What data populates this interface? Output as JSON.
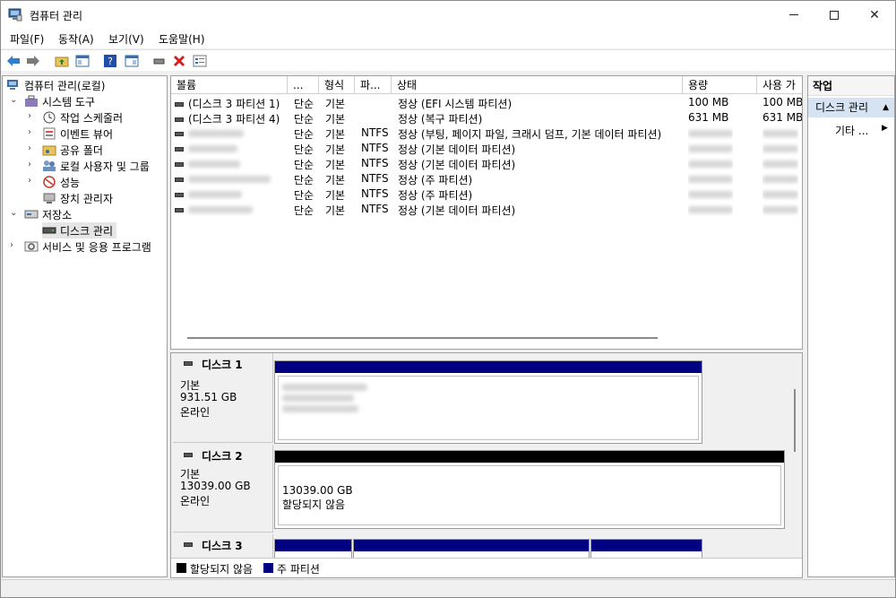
{
  "window": {
    "title": "컴퓨터 관리"
  },
  "menu": [
    "파일(F)",
    "동작(A)",
    "보기(V)",
    "도움말(H)"
  ],
  "toolbar": {
    "icons": [
      "back-arrow-icon",
      "forward-arrow-icon",
      "up-folder-icon",
      "show-hide-tree-icon",
      "help-icon",
      "show-hide-action-icon",
      "connect-icon",
      "delete-icon",
      "properties-icon"
    ]
  },
  "tree": {
    "root": "컴퓨터 관리(로컬)",
    "system_tools": "시스템 도구",
    "task_scheduler": "작업 스케줄러",
    "event_viewer": "이벤트 뷰어",
    "shared_folders": "공유 폴더",
    "local_users": "로컬 사용자 및 그룹",
    "performance": "성능",
    "device_manager": "장치 관리자",
    "storage": "저장소",
    "disk_management": "디스크 관리",
    "services": "서비스 및 응용 프로그램"
  },
  "volumes": {
    "columns": [
      "볼륨",
      "...",
      "형식",
      "파...",
      "상태",
      "용량",
      "사용 가"
    ],
    "rows": [
      {
        "name": "(디스크 3 파티션 1)",
        "layout": "단순",
        "type": "기본",
        "fs": "",
        "status": "정상 (EFI 시스템 파티션)",
        "capacity": "100 MB",
        "free": "100 MB"
      },
      {
        "name": "(디스크 3 파티션 4)",
        "layout": "단순",
        "type": "기본",
        "fs": "",
        "status": "정상 (복구 파티션)",
        "capacity": "631 MB",
        "free": "631 MB"
      },
      {
        "name": "",
        "layout": "단순",
        "type": "기본",
        "fs": "NTFS",
        "status": "정상 (부팅, 페이지 파일, 크래시 덤프, 기본 데이터 파티션)",
        "capacity": "",
        "free": ""
      },
      {
        "name": "",
        "layout": "단순",
        "type": "기본",
        "fs": "NTFS",
        "status": "정상 (기본 데이터 파티션)",
        "capacity": "",
        "free": ""
      },
      {
        "name": "",
        "layout": "단순",
        "type": "기본",
        "fs": "NTFS",
        "status": "정상 (기본 데이터 파티션)",
        "capacity": "",
        "free": ""
      },
      {
        "name": "",
        "layout": "단순",
        "type": "기본",
        "fs": "NTFS",
        "status": "정상 (주 파티션)",
        "capacity": "",
        "free": ""
      },
      {
        "name": "",
        "layout": "단순",
        "type": "기본",
        "fs": "NTFS",
        "status": "정상 (주 파티션)",
        "capacity": "",
        "free": ""
      },
      {
        "name": "",
        "layout": "단순",
        "type": "기본",
        "fs": "NTFS",
        "status": "정상 (기본 데이터 파티션)",
        "capacity": "",
        "free": ""
      }
    ]
  },
  "disks": [
    {
      "name": "디스크 1",
      "type": "기본",
      "size": "931.51 GB",
      "state": "온라인"
    },
    {
      "name": "디스크 2",
      "type": "기본",
      "size": "13039.00 GB",
      "state": "온라인",
      "partition_size": "13039.00 GB",
      "partition_label": "할당되지 않음"
    },
    {
      "name": "디스크 3"
    }
  ],
  "legend": {
    "unallocated": "할당되지 않음",
    "primary": "주 파티션"
  },
  "actions": {
    "header": "작업",
    "group": "디스크 관리",
    "item": "기타 ..."
  },
  "colors": {
    "primary_partition": "#000080",
    "unallocated": "#000000",
    "selected_action": "#d5e3f3"
  }
}
